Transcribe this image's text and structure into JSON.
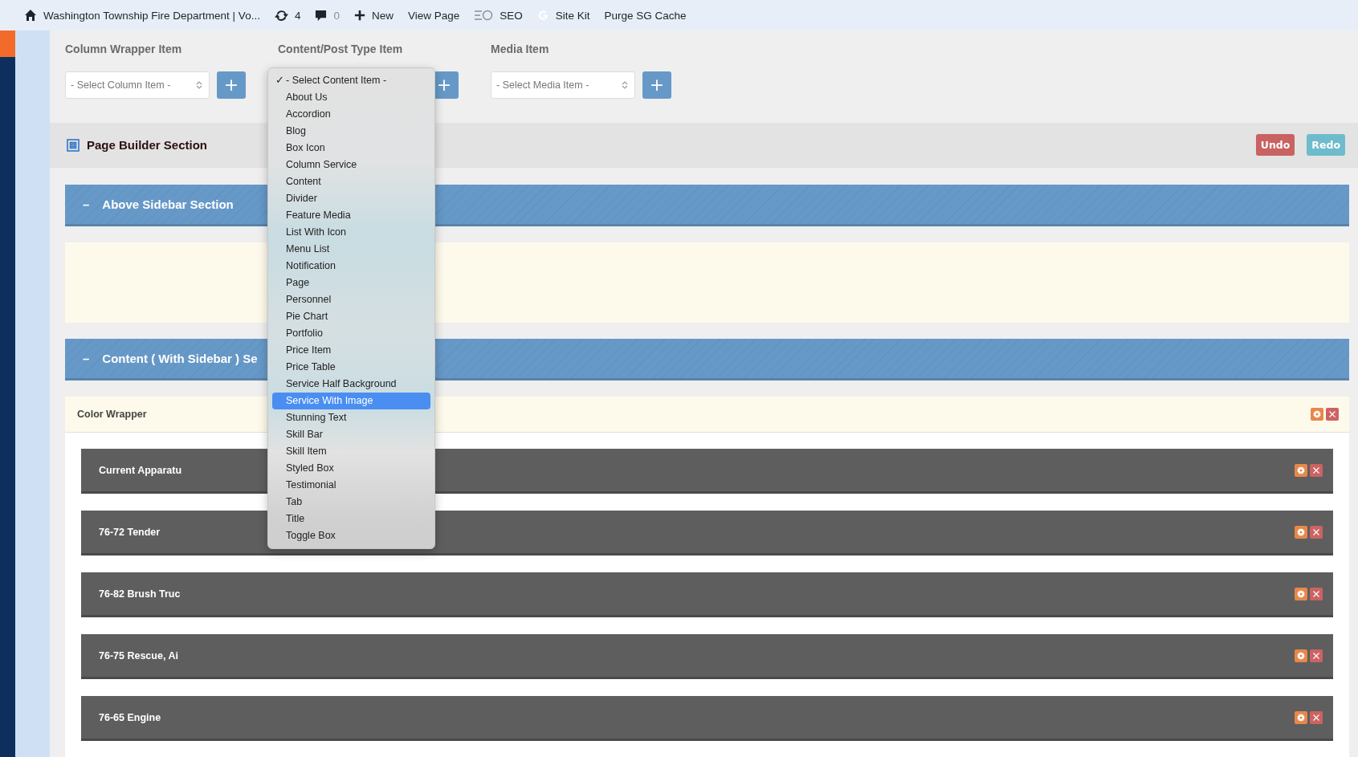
{
  "admin_bar": {
    "site_title": "Washington Township Fire Department | Vo...",
    "updates_count": "4",
    "comments_count": "0",
    "new_label": "New",
    "view_page": "View Page",
    "seo": "SEO",
    "site_kit": "Site Kit",
    "purge_cache": "Purge SG Cache"
  },
  "item_pickers": [
    {
      "label": "Column Wrapper Item",
      "placeholder": "- Select Column Item -",
      "add": "+"
    },
    {
      "label": "Content/Post Type Item",
      "add": "+"
    },
    {
      "label": "Media Item",
      "placeholder": "- Select Media Item -",
      "add": "+"
    }
  ],
  "page_builder": {
    "title": "Page Builder Section",
    "undo": "Undo",
    "redo": "Redo"
  },
  "sections": [
    {
      "toggle": "–",
      "title": "Above Sidebar Section",
      "kind": "empty"
    },
    {
      "toggle": "–",
      "title": "Content ( With Sidebar ) Se",
      "kind": "wrapper"
    }
  ],
  "color_wrapper": {
    "title": "Color Wrapper",
    "items": [
      {
        "title": "Current Apparatu"
      },
      {
        "title": "76-72 Tender"
      },
      {
        "title": "76-82 Brush Truc"
      },
      {
        "title": "76-75 Rescue, Ai"
      },
      {
        "title": "76-65 Engine"
      }
    ]
  },
  "dropdown": {
    "check_mark": "✓",
    "options": [
      {
        "label": "- Select Content Item -",
        "checked": true,
        "selected": false
      },
      {
        "label": "About Us",
        "checked": false,
        "selected": false
      },
      {
        "label": "Accordion",
        "checked": false,
        "selected": false
      },
      {
        "label": "Blog",
        "checked": false,
        "selected": false
      },
      {
        "label": "Box Icon",
        "checked": false,
        "selected": false
      },
      {
        "label": "Column Service",
        "checked": false,
        "selected": false
      },
      {
        "label": "Content",
        "checked": false,
        "selected": false
      },
      {
        "label": "Divider",
        "checked": false,
        "selected": false
      },
      {
        "label": "Feature Media",
        "checked": false,
        "selected": false
      },
      {
        "label": "List With Icon",
        "checked": false,
        "selected": false
      },
      {
        "label": "Menu List",
        "checked": false,
        "selected": false
      },
      {
        "label": "Notification",
        "checked": false,
        "selected": false
      },
      {
        "label": "Page",
        "checked": false,
        "selected": false
      },
      {
        "label": "Personnel",
        "checked": false,
        "selected": false
      },
      {
        "label": "Pie Chart",
        "checked": false,
        "selected": false
      },
      {
        "label": "Portfolio",
        "checked": false,
        "selected": false
      },
      {
        "label": "Price Item",
        "checked": false,
        "selected": false
      },
      {
        "label": "Price Table",
        "checked": false,
        "selected": false
      },
      {
        "label": "Service Half Background",
        "checked": false,
        "selected": false
      },
      {
        "label": "Service With Image",
        "checked": false,
        "selected": true
      },
      {
        "label": "Stunning Text",
        "checked": false,
        "selected": false
      },
      {
        "label": "Skill Bar",
        "checked": false,
        "selected": false
      },
      {
        "label": "Skill Item",
        "checked": false,
        "selected": false
      },
      {
        "label": "Styled Box",
        "checked": false,
        "selected": false
      },
      {
        "label": "Testimonial",
        "checked": false,
        "selected": false
      },
      {
        "label": "Tab",
        "checked": false,
        "selected": false
      },
      {
        "label": "Title",
        "checked": false,
        "selected": false
      },
      {
        "label": "Toggle Box",
        "checked": false,
        "selected": false
      }
    ]
  }
}
